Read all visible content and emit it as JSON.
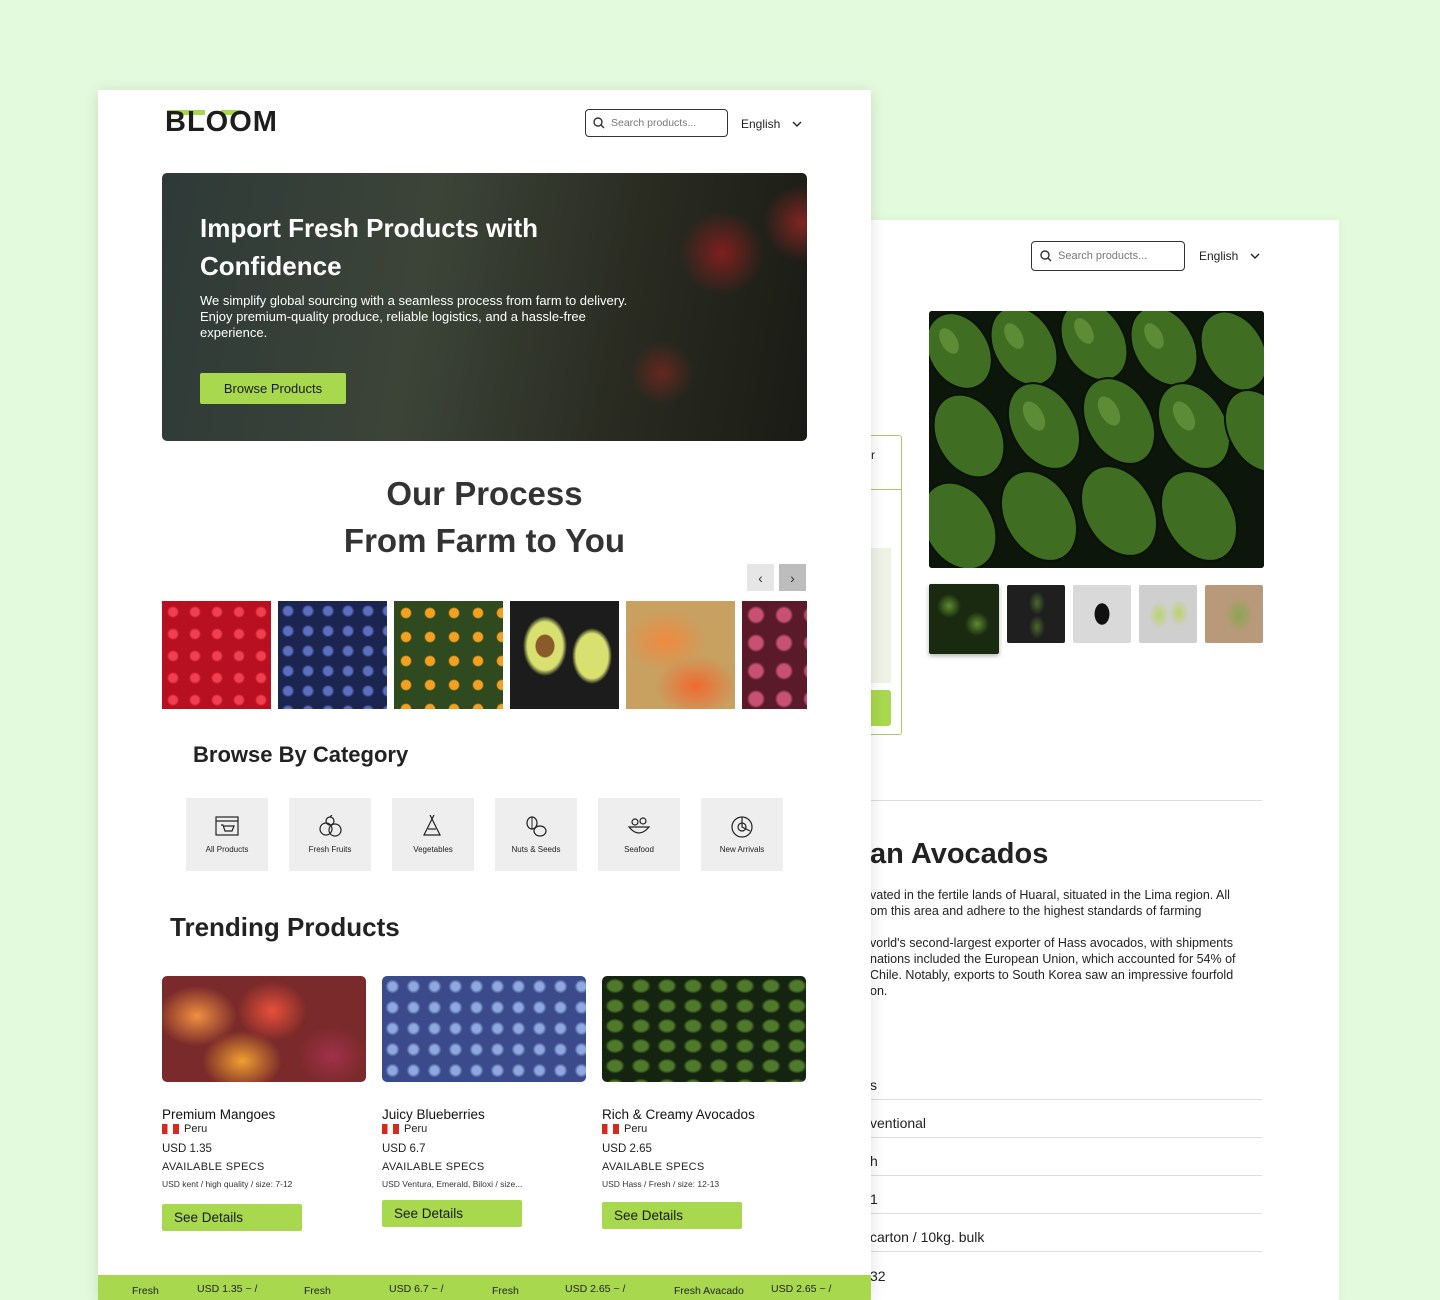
{
  "colors": {
    "background": "#e4fadc",
    "accent": "#a8d84e",
    "text": "#1f1f1f"
  },
  "detail_page": {
    "search_placeholder": "Search products...",
    "language": "English",
    "form_header_fragment": "r",
    "title_fragment": "an Avocados",
    "description": [
      "vated in the fertile lands of Huaral, situated in the Lima region. All",
      "om this area and adhere to the highest standards of farming",
      "vorld's second-largest exporter of Hass avocados, with shipments",
      "nations included the European Union, which accounted for 54% of",
      "Chile. Notably, exports to South Korea saw an impressive fourfold",
      "on."
    ],
    "spec_rows": [
      "s",
      "ventional",
      "h",
      "1",
      "carton / 10kg. bulk",
      "32"
    ]
  },
  "home": {
    "logo": "BLOOM",
    "search_placeholder": "Search products...",
    "language": "English",
    "hero": {
      "title": "Import Fresh Products with Confidence",
      "text": "We simplify global sourcing with a seamless process from farm to delivery. Enjoy premium-quality produce, reliable logistics, and a hassle-free experience.",
      "button": "Browse Products"
    },
    "process_title_line1": "Our Process",
    "process_title_line2": "From Farm to You",
    "carousel_prev": "‹",
    "carousel_next": "›",
    "browse_category_title": "Browse By Category",
    "categories": [
      {
        "label": "All Products",
        "icon": "cart-icon"
      },
      {
        "label": "Fresh Fruits",
        "icon": "fruits-icon"
      },
      {
        "label": "Vegetables",
        "icon": "vegetables-icon"
      },
      {
        "label": "Nuts  & Seeds",
        "icon": "nuts-icon"
      },
      {
        "label": "Seafood",
        "icon": "seafood-icon"
      },
      {
        "label": "New Arrivals",
        "icon": "new-arrivals-icon"
      }
    ],
    "trending_title": "Trending Products",
    "products": [
      {
        "name": "Premium Mangoes",
        "origin": "Peru",
        "price": "USD 1.35",
        "specs_heading": "AVAILABLE SPECS",
        "specs": "USD kent / high quality / size: 7-12",
        "button": "See Details"
      },
      {
        "name": "Juicy Blueberries",
        "origin": "Peru",
        "price": "USD 6.7",
        "specs_heading": "AVAILABLE SPECS",
        "specs": "USD Ventura, Emerald, Biloxi / size...",
        "button": "See Details"
      },
      {
        "name": "Rich & Creamy Avocados",
        "origin": "Peru",
        "price": "USD 2.65",
        "specs_heading": "AVAILABLE SPECS",
        "specs": "USD Hass / Fresh / size: 12-13",
        "button": "See Details"
      }
    ],
    "ticker": [
      {
        "label": "Fresh",
        "price": "USD 1.35 ~ /"
      },
      {
        "label": "Fresh",
        "price": "USD 6.7 ~ /"
      },
      {
        "label": "Fresh",
        "price": "USD 2.65 ~ /"
      },
      {
        "label": "Fresh Avacado",
        "price": "USD 2.65 ~ /"
      }
    ]
  }
}
